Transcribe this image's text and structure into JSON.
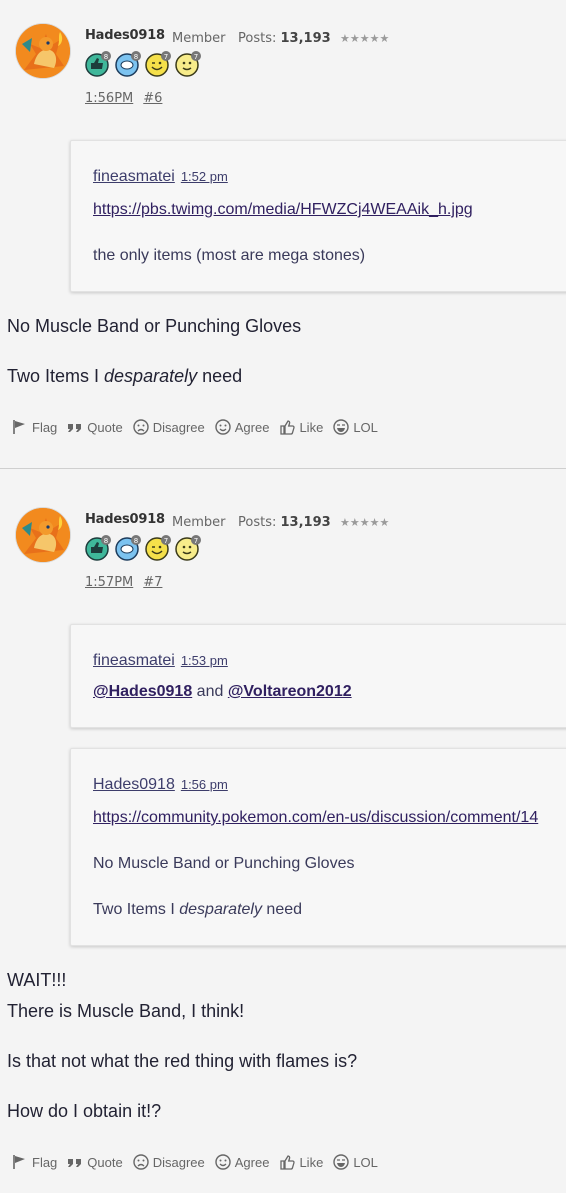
{
  "posts": [
    {
      "author": "Hades0918",
      "role": "Member",
      "posts_label": "Posts:",
      "posts_count": "13,193",
      "rank_stars": "★★★★★",
      "badges": [
        {
          "icon": "thumbs-up-badge-icon",
          "count": "8"
        },
        {
          "icon": "speech-bubble-badge-icon",
          "count": "8"
        },
        {
          "icon": "wink-face-badge-icon",
          "count": "7"
        },
        {
          "icon": "smile-face-badge-icon",
          "count": "7"
        }
      ],
      "time": "1:56PM",
      "permalink": "#6",
      "quotes": [
        {
          "author": "fineasmatei",
          "time": "1:52 pm",
          "link": "https://pbs.twimg.com/media/HFWZCj4WEAAik_h.jpg",
          "text": "the only items (most are mega stones)"
        }
      ],
      "body": {
        "line1": "No Muscle Band or Punching Gloves",
        "line2_pre": "Two Items I ",
        "line2_em": "desparately",
        "line2_post": " need"
      }
    },
    {
      "author": "Hades0918",
      "role": "Member",
      "posts_label": "Posts:",
      "posts_count": "13,193",
      "rank_stars": "★★★★★",
      "badges": [
        {
          "icon": "thumbs-up-badge-icon",
          "count": "8"
        },
        {
          "icon": "speech-bubble-badge-icon",
          "count": "8"
        },
        {
          "icon": "wink-face-badge-icon",
          "count": "7"
        },
        {
          "icon": "smile-face-badge-icon",
          "count": "7"
        }
      ],
      "time": "1:57PM",
      "permalink": "#7",
      "quotes": [
        {
          "author": "fineasmatei",
          "time": "1:53 pm",
          "mention1": "@Hades0918",
          "and": "and",
          "mention2": "@Voltareon2012"
        },
        {
          "author": "Hades0918",
          "time": "1:56 pm",
          "link": "https://community.pokemon.com/en-us/discussion/comment/14",
          "line1": "No Muscle Band or Punching Gloves",
          "line2_pre": "Two Items I ",
          "line2_em": "desparately",
          "line2_post": " need"
        }
      ],
      "body": {
        "line1": "WAIT!!!",
        "line2": "There is Muscle Band, I think!",
        "line3": "Is that not what the red thing with flames is?",
        "line4": "How do I obtain it!?"
      }
    }
  ],
  "actions": {
    "flag": "Flag",
    "quote": "Quote",
    "disagree": "Disagree",
    "agree": "Agree",
    "like": "Like",
    "lol": "LOL"
  },
  "colors": {
    "background": "#f4f4f4",
    "link": "#302060",
    "avatar_orange": "#f28a1e"
  }
}
